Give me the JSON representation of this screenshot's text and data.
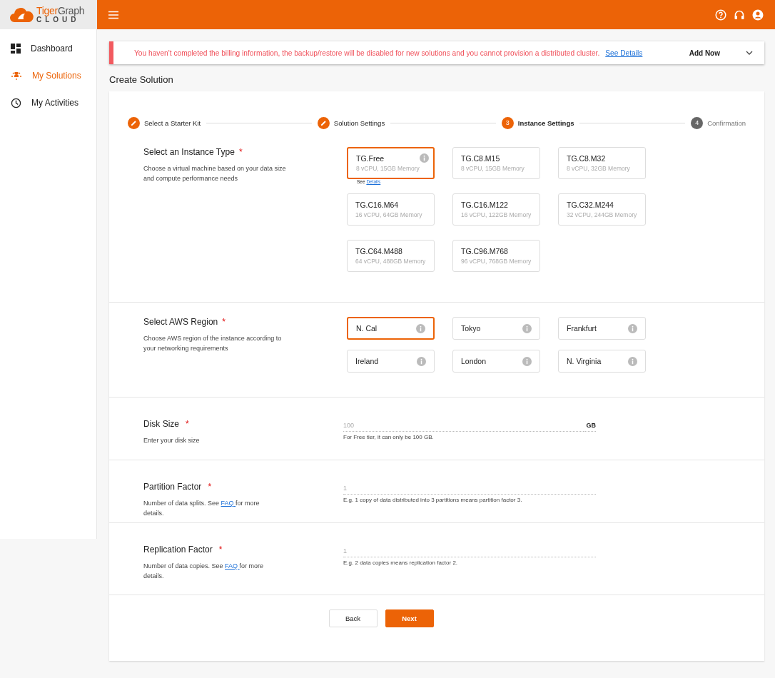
{
  "brand": {
    "name_part1": "Tiger",
    "name_part2": "Graph",
    "subtitle": "CLOUD"
  },
  "sidebar": {
    "items": [
      {
        "label": "Dashboard",
        "selected": false
      },
      {
        "label": "My Solutions",
        "selected": true
      },
      {
        "label": "My Activities",
        "selected": false
      }
    ]
  },
  "banner": {
    "message": "You haven't completed the billing information, the backup/restore will be disabled for new solutions and you cannot provision a distributed cluster.",
    "link": "See Details",
    "action": "Add Now"
  },
  "page_title": "Create Solution",
  "steps": [
    {
      "label": "Select a Starter Kit",
      "completed": true,
      "selected": false
    },
    {
      "label": "Solution Settings",
      "completed": true,
      "selected": false
    },
    {
      "number": "3",
      "label": "Instance Settings",
      "completed": false,
      "selected": true
    },
    {
      "number": "4",
      "label": "Confirmation",
      "completed": false,
      "selected": false
    }
  ],
  "instance_section": {
    "title": "Select an Instance Type",
    "required_mark": "*",
    "description": "Choose a virtual machine based on your data size and compute performance needs",
    "options": [
      {
        "name": "TG.Free",
        "spec": "8 vCPU, 15GB Memory",
        "selected": true,
        "info": true,
        "note": "See",
        "note_link": "Details"
      },
      {
        "name": "TG.C8.M15",
        "spec": "8 vCPU, 15GB Memory",
        "selected": false,
        "info": false
      },
      {
        "name": "TG.C8.M32",
        "spec": "8 vCPU, 32GB Memory",
        "selected": false,
        "info": false
      },
      {
        "name": "TG.C16.M64",
        "spec": "16 vCPU, 64GB Memory",
        "selected": false,
        "info": false
      },
      {
        "name": "TG.C16.M122",
        "spec": "16 vCPU, 122GB Memory",
        "selected": false,
        "info": false
      },
      {
        "name": "TG.C32.M244",
        "spec": "32 vCPU, 244GB Memory",
        "selected": false,
        "info": false
      },
      {
        "name": "TG.C64.M488",
        "spec": "64 vCPU, 488GB Memory",
        "selected": false,
        "info": false
      },
      {
        "name": "TG.C96.M768",
        "spec": "96 vCPU, 768GB Memory",
        "selected": false,
        "info": false
      }
    ]
  },
  "region_section": {
    "title": "Select AWS Region",
    "required_mark": "*",
    "description": "Choose AWS region of the instance according to your networking requirements",
    "options": [
      {
        "name": "N. Cal",
        "selected": true
      },
      {
        "name": "Tokyo",
        "selected": false
      },
      {
        "name": "Frankfurt",
        "selected": false
      },
      {
        "name": "Ireland",
        "selected": false
      },
      {
        "name": "London",
        "selected": false
      },
      {
        "name": "N. Virginia",
        "selected": false
      }
    ]
  },
  "fields": [
    {
      "title": "Disk Size",
      "required_mark": "*",
      "description": "Enter your disk size",
      "placeholder": "100",
      "unit": "GB",
      "help": "For Free tier, it can only be 100 GB."
    },
    {
      "title": "Partition Factor",
      "required_mark": "*",
      "description": "Number of data splits. See ",
      "description_link": "FAQ ",
      "description_after": "for more details.",
      "placeholder": "1",
      "help": "E.g. 1 copy of data distributed into 3 partitions means partition factor 3."
    },
    {
      "title": "Replication Factor",
      "required_mark": "*",
      "description": "Number of data copies. See ",
      "description_link": "FAQ ",
      "description_after": "for more details.",
      "placeholder": "1",
      "help": "E.g. 2 data copies means replication factor 2."
    }
  ],
  "buttons": {
    "back": "Back",
    "next": "Next"
  }
}
